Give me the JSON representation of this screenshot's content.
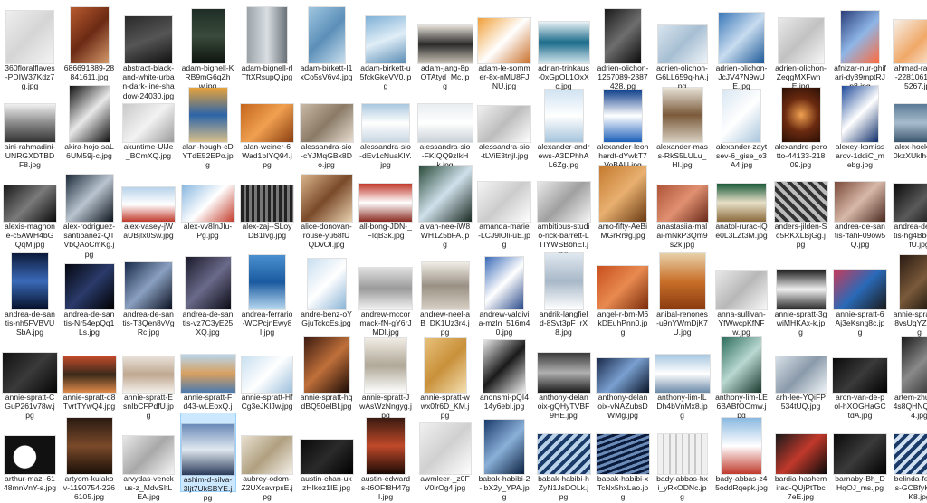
{
  "window": {
    "view": "Large icons"
  },
  "files": [
    {
      "name": "360floralflaves-PDIW37Kdz7g.jpg",
      "fill": "linear-gradient(135deg,#eeeeee,#d5d5d5,#f4f4f4)"
    },
    {
      "name": "686691889-28841611.jpg",
      "fill": "linear-gradient(135deg,#b85a2e,#6b2a14,#d59a6b)"
    },
    {
      "name": "abstract-black-and-white-urban-dark-line-shadow-24030.jpg",
      "fill": "linear-gradient(160deg,#2a2a2a,#555555,#111111)"
    },
    {
      "name": "adam-bignell-KRB9mG6qZhw.jpg",
      "fill": "linear-gradient(180deg,#1f2e25,#3a4a3b,#0d140f)"
    },
    {
      "name": "adam-bignell-rlTftXRsupQ.jpg",
      "fill": "linear-gradient(90deg,#9aa3a8,#d9dee2,#6a7378)"
    },
    {
      "name": "adam-birkett-I1xCo5sV6v4.jpg",
      "fill": "linear-gradient(135deg,#9fc6e0,#5c8fb8,#c9e0ee)"
    },
    {
      "name": "adam-birkett-u5fckGkeVV0.jpg",
      "fill": "linear-gradient(160deg,#7fb0d6,#e0eef7,#5b8db5)"
    },
    {
      "name": "adam-jang-8pOTAtyd_Mc.jpg",
      "fill": "linear-gradient(180deg,#e6e1d8,#2b2b2b,#c9c2b5)"
    },
    {
      "name": "adam-le-sommer-8x-nMU8FJNU.jpg",
      "fill": "linear-gradient(135deg,#f0a03a,#ffffff,#c9702a)"
    },
    {
      "name": "adrian-trinkaus-0xGpOL1OxXc.jpg",
      "fill": "linear-gradient(180deg,#eaf2f7,#1b6b8a,#d4e6ee)"
    },
    {
      "name": "adrien-olichon-1257089-2387428.jpg",
      "fill": "linear-gradient(135deg,#1a1a1a,#6e6e6e,#0a0a0a)"
    },
    {
      "name": "adrien-olichon-G6LL659q-hA.jpg",
      "fill": "linear-gradient(135deg,#d8e4ee,#a7bfd3,#eff4f8)"
    },
    {
      "name": "adrien-olichon-JcJV47N9wUE.jpg",
      "fill": "linear-gradient(135deg,#3a78b8,#c8dcef,#1e5a98)"
    },
    {
      "name": "adrien-olichon-ZeqgMXFwn_E.jpg",
      "fill": "linear-gradient(135deg,#e9e9e9,#c2c2c2,#f7f7f7)"
    },
    {
      "name": "afnizar-nur-ghifari-dy39mptRJp8.jpg",
      "fill": "linear-gradient(135deg,#2a3d7a,#8fb6e6,#ff6a3d)"
    },
    {
      "name": "ahmad-ramlee-2281061-4125267.jpg",
      "fill": "linear-gradient(135deg,#f6f0e8,#f0a868,#ffffff)"
    },
    {
      "name": "aini-rahmadini-UNRGXDTBDF8.jpg",
      "fill": "linear-gradient(180deg,#f1f1f1,#8a8a8a,#333333)"
    },
    {
      "name": "akira-hojo-saL6UM59j-c.jpg",
      "fill": "linear-gradient(135deg,#111111,#e8e8e8,#111111)"
    },
    {
      "name": "akuntime-UlJe_BCmXQ.jpg",
      "fill": "linear-gradient(135deg,#c9c9c9,#f2f2f2,#9c9c9c)"
    },
    {
      "name": "alan-hough-cDYTdE52EPo.jpg",
      "fill": "linear-gradient(180deg,#e8a33c,#2c64a8,#d8c08a)"
    },
    {
      "name": "alan-weiner-6Wad1bIYQ94.jpg",
      "fill": "linear-gradient(135deg,#c4661e,#f0a050,#8a3e10)"
    },
    {
      "name": "alessandra-sio-cYJMqGBx8Do.jpg",
      "fill": "linear-gradient(135deg,#c8b9a6,#8a7a66,#e8ddd0)"
    },
    {
      "name": "alessandra-sio-dEv1cNuaKIY.jpg",
      "fill": "linear-gradient(180deg,#a9c7de,#ffffff,#c7d6e2)"
    },
    {
      "name": "alessandra-sio-FKIQQ9zIkHk.jpg",
      "fill": "linear-gradient(180deg,#e8edf0,#ffffff,#c9d2d8)"
    },
    {
      "name": "alessandra-sio-tLViE3tnjI.jpg",
      "fill": "linear-gradient(135deg,#f0f0f0,#bdbdbd,#ffffff)"
    },
    {
      "name": "alexander-andrews-A3DPhhAL6Zg.jpg",
      "fill": "linear-gradient(180deg,#d0e3f2,#ffffff,#a6c4dc)"
    },
    {
      "name": "alexander-leonhardt-dYwkT7VoBAU.jpg",
      "fill": "linear-gradient(180deg,#0c3d8a,#ffffff,#1b5fb8)"
    },
    {
      "name": "alexander-mass-RkS5LULu_HI.jpg",
      "fill": "linear-gradient(180deg,#e8e2d8,#7a5a3a,#d8cfc0)"
    },
    {
      "name": "alexander-zaytsev-6_gise_o3A4.jpg",
      "fill": "linear-gradient(135deg,#d8e6f2,#ffffff,#a9c5dd)"
    },
    {
      "name": "alexandre-perotto-44133-21809.jpg",
      "fill": "radial-gradient(circle,#f0a050,#6a2a10,#2a0f05)"
    },
    {
      "name": "alexey-komissarov-1ddiC_mebg.jpg",
      "fill": "linear-gradient(135deg,#1e4a9a,#ffffff,#0f2e6a)"
    },
    {
      "name": "alex-hockett-h0kzXUklh-c.jpg",
      "fill": "linear-gradient(180deg,#5a7a96,#a8bccd,#3a566e)"
    },
    {
      "name": "alexis-magnone-c5AWH4bGQqM.jpg",
      "fill": "linear-gradient(135deg,#1a1a1a,#7a7a7a,#0a0a0a)"
    },
    {
      "name": "alex-rodriguez-santibanez-QTVbQAoCmKg.jpg",
      "fill": "linear-gradient(135deg,#1d2b3a,#b9c4cf,#0c141c)"
    },
    {
      "name": "alex-vasey-jWaUBjIx0Sw.jpg",
      "fill": "linear-gradient(180deg,#b8d3ea,#ffffff,#c0392b)"
    },
    {
      "name": "alex-vv8InJIu-Pg.jpg",
      "fill": "linear-gradient(135deg,#8ab8e0,#ffffff,#c23b2a)"
    },
    {
      "name": "alex-zaj--SLoyDB1Ivg.jpg",
      "fill": "repeating-linear-gradient(90deg,#222222 0 3px,#777777 3px 6px)"
    },
    {
      "name": "alice-donovan-rouse-yu68fUQDvOI.jpg",
      "fill": "linear-gradient(135deg,#d9b48a,#7a4a2a,#e9d2b0)"
    },
    {
      "name": "all-bong-JDN-_FIqB3k.jpg",
      "fill": "linear-gradient(180deg,#c0392b,#ffffff,#8a2a20)"
    },
    {
      "name": "alvan-nee-iW8WH1Z5bFA.jpg",
      "fill": "linear-gradient(135deg,#2a4a3a,#cfe0ea,#1a2a22)"
    },
    {
      "name": "amanda-marie-LCJ9lOli-uE.jpg",
      "fill": "linear-gradient(135deg,#f4f4f4,#cccccc,#ffffff)"
    },
    {
      "name": "ambitious-studio-rick-barrett-LTIYWSBbhEI.jpg",
      "fill": "linear-gradient(135deg,#e8e8e8,#a0a0a0,#f6f6f6)"
    },
    {
      "name": "amo-fifty-AeBiMGrRr9g.jpg",
      "fill": "linear-gradient(135deg,#c47a2e,#e8b070,#6a3a12)"
    },
    {
      "name": "anastasiia-malai-mNkP3Qm9s2k.jpg",
      "fill": "linear-gradient(135deg,#b0553a,#e09070,#6a2a1a)"
    },
    {
      "name": "anatol-rurac-iQe0L3LZt3M.jpg",
      "fill": "linear-gradient(180deg,#1a5a3a,#e8e0c8,#8a6a3a)"
    },
    {
      "name": "anders-jilden-Sc5RKXLBjGg.jpg",
      "fill": "repeating-linear-gradient(45deg,#333333 0 4px,#bbbbbb 4px 8px)"
    },
    {
      "name": "andrea-de-santis-ffahF09ow5Q.jpg",
      "fill": "linear-gradient(135deg,#7a4a3a,#d8b8a8,#4a2a20)"
    },
    {
      "name": "andrea-de-santis-hg4BbgmvcfU.jpg",
      "fill": "linear-gradient(135deg,#0a0a0a,#5a5a5a,#000000)"
    },
    {
      "name": "andrea-de-santis-nh5FVBVUSbA.jpg",
      "fill": "linear-gradient(180deg,#0c1a3a,#3a6ab8,#05102a)"
    },
    {
      "name": "andrea-de-santis-Nr54epQq1Ls.jpg",
      "fill": "linear-gradient(135deg,#050810,#2a3a6a,#000000)"
    },
    {
      "name": "andrea-de-santis-T3Qen8vVgRc.jpg",
      "fill": "linear-gradient(135deg,#1a2a4a,#8aa0c0,#0a1020)"
    },
    {
      "name": "andrea-de-santis-vz7C3yE25XQ.jpg",
      "fill": "linear-gradient(135deg,#1a1a2a,#6a6a8a,#0a0a15)"
    },
    {
      "name": "andrea-ferrario-WCPcjnEwy8I.jpg",
      "fill": "linear-gradient(180deg,#4a90d0,#1a5aa0,#b8d8f0)"
    },
    {
      "name": "andre-benz-oYGjuTckcEs.jpg",
      "fill": "linear-gradient(135deg,#c8dff0,#ffffff,#8ab4d6)"
    },
    {
      "name": "andrew-mccormack-fN-gY6rJMDI.jpg",
      "fill": "linear-gradient(180deg,#e0e0e0,#9a9a9a,#f2f2f2)"
    },
    {
      "name": "andrew-neel-aB_DK1Uz3r4.jpg",
      "fill": "linear-gradient(180deg,#f0ede6,#9a9084,#d8d0c4)"
    },
    {
      "name": "andrew-valdivia-mzln_516m40.jpg",
      "fill": "linear-gradient(135deg,#3a6ab8,#ffffff,#2a4a8a)"
    },
    {
      "name": "andrik-langfield-8Svt3pF_rX8.jpg",
      "fill": "linear-gradient(180deg,#e0e8f0,#a8b8c8,#ffffff)"
    },
    {
      "name": "angel-r-bm-M6kDEuhPnn0.jpg",
      "fill": "linear-gradient(135deg,#c8501e,#e88a50,#7a2a0a)"
    },
    {
      "name": "anibal-renones-u9nYWmDjK7U.jpg",
      "fill": "linear-gradient(180deg,#e8d0a8,#c8702a,#8a3a10)"
    },
    {
      "name": "anna-sullivan-YfWwcpKfNFw.jpg",
      "fill": "linear-gradient(135deg,#e8e8e8,#b8b8b8,#f8f8f8)"
    },
    {
      "name": "annie-spratt-3gwiMHKAx-k.jpg",
      "fill": "linear-gradient(180deg,#1a1a1a,#f0f0f0,#2a2a2a)"
    },
    {
      "name": "annie-spratt-6Aj3eKsng8c.jpg",
      "fill": "linear-gradient(135deg,#c83a5a,#2a6ab8,#1a1a1a)"
    },
    {
      "name": "annie-spratt-7L8vsUqYZcA.jpg",
      "fill": "linear-gradient(135deg,#2a1a12,#7a5a3a,#0a0805)"
    },
    {
      "name": "annie-spratt-CGuP261v78w.jpg",
      "fill": "linear-gradient(135deg,#111111,#3a3a3a,#050505)"
    },
    {
      "name": "annie-spratt-d8TvrtTYwQ4.jpg",
      "fill": "linear-gradient(180deg,#c04a2a,#3a2a1a,#e08a4a)"
    },
    {
      "name": "annie-spratt-EsnIbCFPdfU.jpg",
      "fill": "linear-gradient(180deg,#e8e0d8,#c0a890,#f4f0ea)"
    },
    {
      "name": "annie-spratt-Fd43-wLEoxQ.jpg",
      "fill": "linear-gradient(180deg,#b8d4ea,#d8a060,#4a7ab0)"
    },
    {
      "name": "annie-spratt-HfCg3eJKIJw.jpg",
      "fill": "linear-gradient(135deg,#c8dff0,#ffffff,#9ec0dc)"
    },
    {
      "name": "annie-spratt-hqdBQ50eIBI.jpg",
      "fill": "linear-gradient(135deg,#3a1a10,#c0703a,#1a0a05)"
    },
    {
      "name": "annie-spratt-JwAsWzNngyg.jpg",
      "fill": "linear-gradient(180deg,#f0ece4,#b0a898,#ffffff)"
    },
    {
      "name": "annie-spratt-wwx0fr6D_KM.jpg",
      "fill": "linear-gradient(135deg,#e8c07a,#c8903a,#f4e0b0)"
    },
    {
      "name": "anonsmi-pQI414y6ebI.jpg",
      "fill": "linear-gradient(135deg,#e8e8e8,#1a1a1a,#f0f0f0)"
    },
    {
      "name": "anthony-delanoix-gQHyTVBF9HE.jpg",
      "fill": "linear-gradient(180deg,#3a3a3a,#b0b0b0,#1a1a1a)"
    },
    {
      "name": "anthony-delanoix-vNAZubsDWMg.jpg",
      "fill": "linear-gradient(135deg,#1a2a4a,#7aa0d0,#0a1428)"
    },
    {
      "name": "anthony-lim-ILDh4bVnMx8.jpg",
      "fill": "linear-gradient(180deg,#a8c8e0,#ffffff,#6a8aa8)"
    },
    {
      "name": "anthony-lim-LE6BABfOOmw.jpg",
      "fill": "linear-gradient(135deg,#2a6a5a,#b8d8d0,#1a3a30)"
    },
    {
      "name": "arh-lee-YQiFP534tUQ.jpg",
      "fill": "linear-gradient(135deg,#d8e0e8,#8a9aaa,#f0f4f8)"
    },
    {
      "name": "aron-van-de-pol-hXOGHaGCtdA.jpg",
      "fill": "linear-gradient(135deg,#0a0a0a,#3a3a3a,#000000)"
    },
    {
      "name": "artem-zhukov-4s8QHNQTHO4.jpg",
      "fill": "linear-gradient(135deg,#1a1a1a,#8a8a8a,#2a2a2a)"
    },
    {
      "name": "arthur-mazi-6148mnVnY-s.jpg",
      "fill": "radial-gradient(circle at 40% 55%,#ffffff 0 30%,#111111 32%)"
    },
    {
      "name": "artyom-kulakov-1190754-2266105.jpg",
      "fill": "linear-gradient(180deg,#2a1a12,#7a4a2a,#1a0f08)"
    },
    {
      "name": "arvydas-venckus-z_MdvSItLEA.jpg",
      "fill": "linear-gradient(135deg,#e8e8e8,#a8a8a8,#f6f6f6)"
    },
    {
      "name": "ashim-d-silva-3ljt7UkSBYE.jpg",
      "fill": "linear-gradient(180deg,#6a8ab8,#e0e8f0,#2a3a5a)"
    },
    {
      "name": "aubrey-odom-Z2UXcavrpsE.jpg",
      "fill": "linear-gradient(135deg,#e8e0d0,#b0a080,#f4f0e8)"
    },
    {
      "name": "austin-chan-ukzHIkoz1IE.jpg",
      "fill": "linear-gradient(135deg,#0a0a0a,#2a2a2a,#000000)"
    },
    {
      "name": "austin-edwards-t6OFf8H47gI.jpg",
      "fill": "linear-gradient(180deg,#3a1a10,#c04a2a,#1a0a05)"
    },
    {
      "name": "awmleer-_z0FV0lrOg4.jpg",
      "fill": "linear-gradient(135deg,#f0f0f0,#d0d0d0,#ffffff)"
    },
    {
      "name": "babak-habibi-2-IbX2y_YPA.jpg",
      "fill": "linear-gradient(135deg,#1a3a6a,#8ab0d8,#0a2040)"
    },
    {
      "name": "babak-habibi-hZyN1JsDOLk.jpg",
      "fill": "repeating-linear-gradient(135deg,#1a3a6a 0 4px,#b8d0e8 4px 8px)"
    },
    {
      "name": "babak-habibi-xTcNx5hxLao.jpg",
      "fill": "repeating-linear-gradient(160deg,#0a1a3a 0 3px,#6a8ab8 3px 6px)"
    },
    {
      "name": "bady-abbas-hxi_yRxODNc.jpg",
      "fill": "repeating-linear-gradient(90deg,#f0f0f0 0 5px,#c8c8c8 5px 7px)"
    },
    {
      "name": "bady-abbas-z45oddRqepk.jpg",
      "fill": "linear-gradient(180deg,#8ab8e0,#ffffff,#c0392b)"
    },
    {
      "name": "bardia-hashemirad-QUjPtTbc7eE.jpg",
      "fill": "linear-gradient(135deg,#1a1a1a,#c0392b,#0a0a0a)"
    },
    {
      "name": "barnaby-Bh_DHqOJ_ms.jpg",
      "fill": "linear-gradient(135deg,#0a0a0a,#3a3a3a,#000000)"
    },
    {
      "name": "belinda-fewings-GCBfyK-GSK8.jpg",
      "fill": "repeating-linear-gradient(135deg,#1a3a6a 0 4px,#d0e0f0 4px 8px)"
    }
  ]
}
